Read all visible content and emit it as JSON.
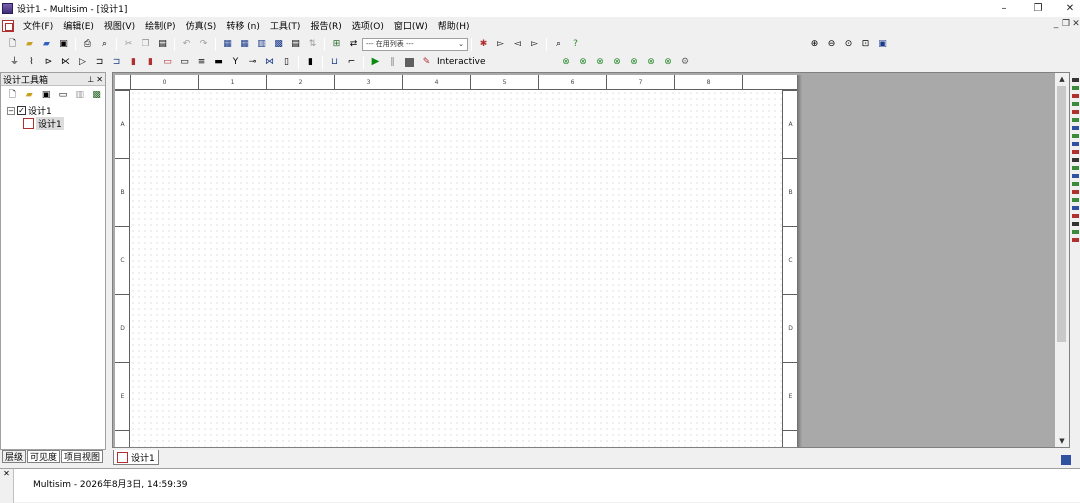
{
  "window": {
    "title": "设计1 - Multisim - [设计1]",
    "minimize": "–",
    "restore": "❐",
    "close": "✕"
  },
  "menu": {
    "items": [
      "文件(F)",
      "编辑(E)",
      "视图(V)",
      "绘制(P)",
      "仿真(S)",
      "转移 (n)",
      "工具(T)",
      "报告(R)",
      "选项(O)",
      "窗口(W)",
      "帮助(H)"
    ]
  },
  "mdi_controls": {
    "minimize": "_",
    "restore": "❐",
    "close": "✕"
  },
  "toolbar": {
    "in_use_list_label": "--- 在用列表 ---",
    "interactive_label": "Interactive"
  },
  "design_toolbox": {
    "title": "设计工具箱",
    "tree_root": "设计1",
    "tree_child": "设计1",
    "tabs": [
      "层级",
      "可见度",
      "项目视图"
    ]
  },
  "sheet": {
    "col_labels": [
      "0",
      "1",
      "2",
      "3",
      "4",
      "5",
      "6",
      "7",
      "8"
    ],
    "row_labels": [
      "A",
      "B",
      "C",
      "D",
      "E"
    ]
  },
  "document_tab": {
    "label": "设计1"
  },
  "status": {
    "message": "Multisim  -  2026年8月3日, 14:59:39",
    "close": "✕"
  }
}
